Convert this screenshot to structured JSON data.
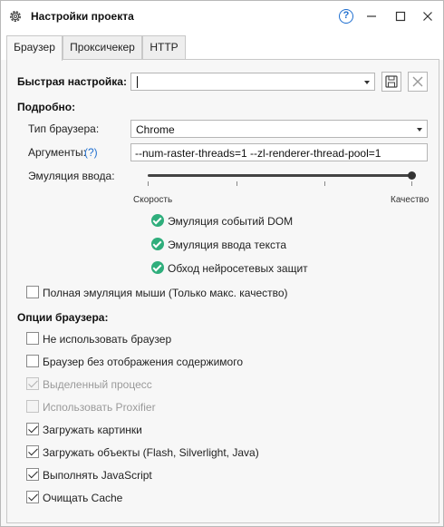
{
  "window": {
    "title": "Настройки проекта",
    "help_label": "?"
  },
  "tabs": [
    {
      "label": "Браузер",
      "active": true
    },
    {
      "label": "Проксичекер",
      "active": false
    },
    {
      "label": "HTTP",
      "active": false
    }
  ],
  "quick_setup": {
    "label": "Быстрая настройка:",
    "value": ""
  },
  "details": {
    "heading": "Подробно:",
    "browser_type_label": "Тип браузера:",
    "browser_type_value": "Chrome",
    "arguments_label": "Аргументы:",
    "arguments_help": "(?)",
    "arguments_value": "--num-raster-threads=1 --zl-renderer-thread-pool=1",
    "input_emulation_label": "Эмуляция ввода:",
    "slider_min_label": "Скорость",
    "slider_max_label": "Качество",
    "slider_level": 1.0,
    "features": [
      "Эмуляция событий DOM",
      "Эмуляция ввода текста",
      "Обход нейросетевых защит"
    ],
    "full_mouse_emulation": {
      "label": "Полная эмуляция мыши (Только макс. качество)",
      "checked": false
    }
  },
  "browser_options": {
    "heading": "Опции браузера:",
    "items": [
      {
        "label": "Не использовать браузер",
        "checked": false,
        "disabled": false
      },
      {
        "label": "Браузер без отображения содержимого",
        "checked": false,
        "disabled": false
      },
      {
        "label": "Выделенный процесс",
        "checked": true,
        "disabled": true
      },
      {
        "label": "Использовать Proxifier",
        "checked": false,
        "disabled": true
      },
      {
        "label": "Загружать картинки",
        "checked": true,
        "disabled": false
      },
      {
        "label": "Загружать объекты (Flash, Silverlight, Java)",
        "checked": true,
        "disabled": false
      },
      {
        "label": "Выполнять JavaScript",
        "checked": true,
        "disabled": false
      },
      {
        "label": "Очищать Cache",
        "checked": true,
        "disabled": false
      }
    ]
  },
  "colors": {
    "accent": "#1f6fd0",
    "success": "#2fae7c"
  }
}
